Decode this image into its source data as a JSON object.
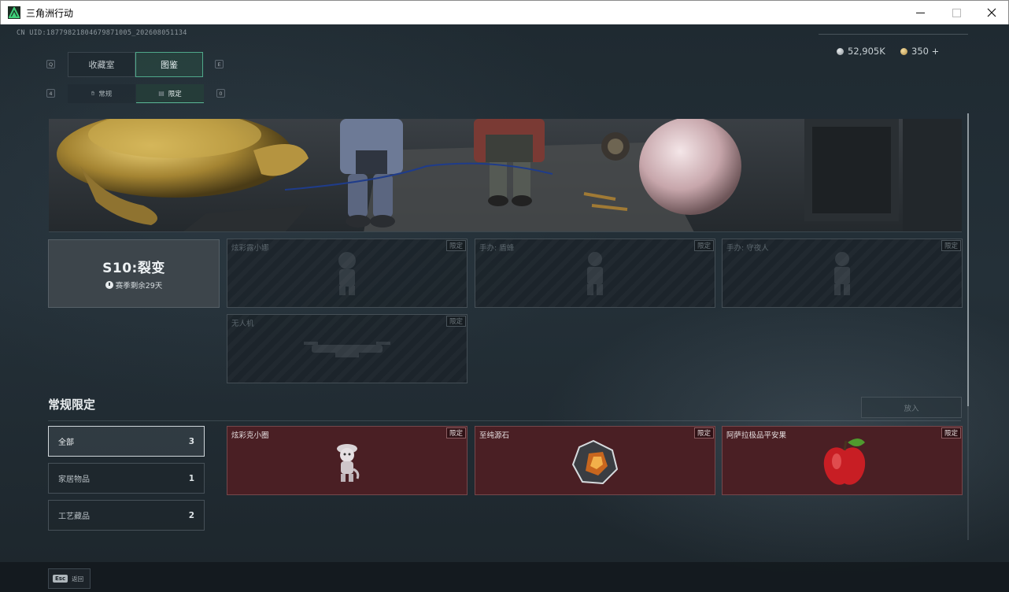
{
  "window": {
    "title": "三角洲行动"
  },
  "header": {
    "uid": "CN UID:18779821804679871005_202608051134",
    "currency": [
      {
        "icon": "silver-coin-icon",
        "value": "52,905K"
      },
      {
        "icon": "gold-coin-icon",
        "value": "350 +"
      }
    ]
  },
  "tabs": {
    "key_left": "Q",
    "key_right": "E",
    "items": [
      {
        "label": "收藏室",
        "active": false
      },
      {
        "label": "图鉴",
        "active": true
      }
    ]
  },
  "subtabs": {
    "key_left": "4",
    "key_right": "0",
    "items": [
      {
        "label": "常规",
        "icon": "hand-icon",
        "active": false
      },
      {
        "label": "限定",
        "icon": "card-icon",
        "active": true
      }
    ]
  },
  "season": {
    "title": "S10:裂变",
    "remaining": "赛季剩余29天"
  },
  "season_items": [
    {
      "name": "炫彩露小娜",
      "badge": "限定"
    },
    {
      "name": "手办: 盾蜂",
      "badge": "限定"
    },
    {
      "name": "手办: 守夜人",
      "badge": "限定"
    },
    {
      "name": "无人机",
      "badge": "限定"
    }
  ],
  "section": {
    "title": "常规限定",
    "put_button": "放入"
  },
  "categories": [
    {
      "label": "全部",
      "count": "3",
      "active": true
    },
    {
      "label": "家居物品",
      "count": "1",
      "active": false
    },
    {
      "label": "工艺藏品",
      "count": "2",
      "active": false
    }
  ],
  "regular_items": [
    {
      "name": "炫彩克小圈",
      "badge": "限定"
    },
    {
      "name": "至纯源石",
      "badge": "限定"
    },
    {
      "name": "阿萨拉极品平安果",
      "badge": "限定"
    }
  ],
  "footer": {
    "esc_key": "Esc",
    "back_label": "返回"
  },
  "colors": {
    "accent": "#4fa88a",
    "owned_card": "#4a1f24"
  }
}
